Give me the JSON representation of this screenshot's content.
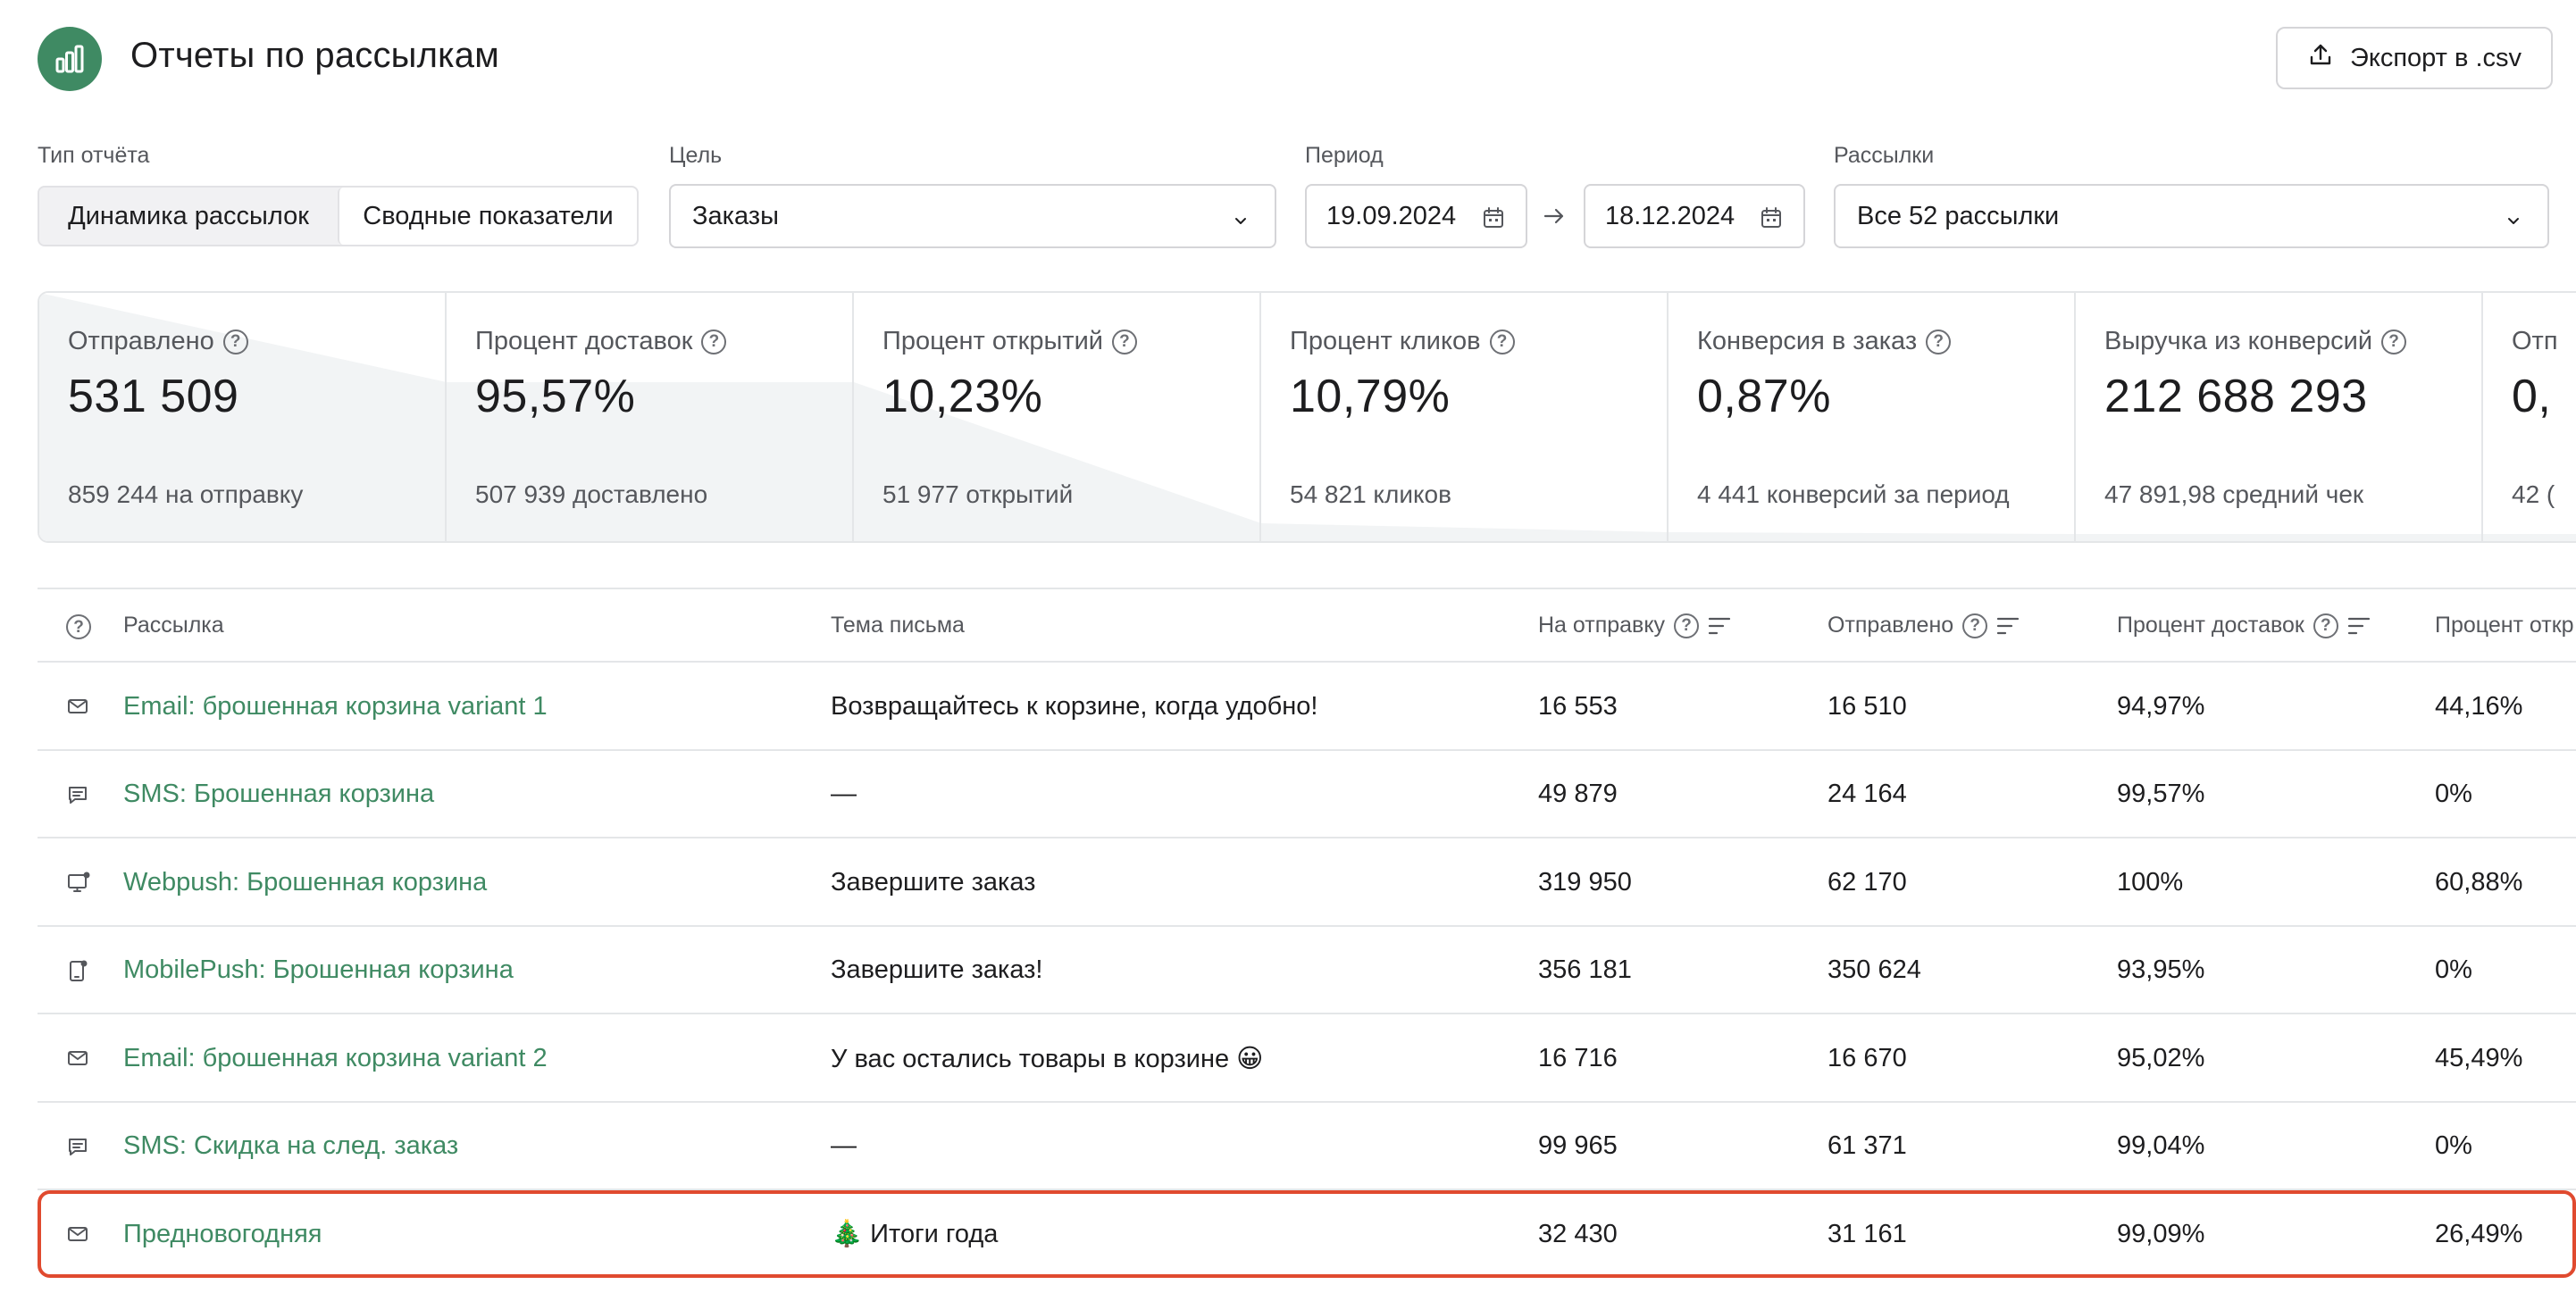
{
  "header": {
    "title": "Отчеты по рассылкам",
    "export_label": "Экспорт в .csv"
  },
  "filters": {
    "report_type": {
      "label": "Тип отчёта",
      "options": [
        "Динамика рассылок",
        "Сводные показатели"
      ],
      "selected": "Динамика рассылок"
    },
    "goal": {
      "label": "Цель",
      "value": "Заказы"
    },
    "period": {
      "label": "Период",
      "from": "19.09.2024",
      "to": "18.12.2024"
    },
    "campaigns": {
      "label": "Рассылки",
      "value": "Все 52 рассылки"
    }
  },
  "metrics": [
    {
      "title": "Отправлено",
      "value": "531 509",
      "sub": "859 244 на отправку"
    },
    {
      "title": "Процент доставок",
      "value": "95,57%",
      "sub": "507 939 доставлено"
    },
    {
      "title": "Процент открытий",
      "value": "10,23%",
      "sub": "51 977 открытий"
    },
    {
      "title": "Процент кликов",
      "value": "10,79%",
      "sub": "54 821 кликов"
    },
    {
      "title": "Конверсия в заказ",
      "value": "0,87%",
      "sub": "4 441 конверсий за период"
    },
    {
      "title": "Выручка из конверсий",
      "value": "212 688 293",
      "sub": "47 891,98 средний чек"
    },
    {
      "title": "Отп",
      "value": "0,",
      "sub": "42 ("
    }
  ],
  "table": {
    "columns": {
      "campaign": "Рассылка",
      "subject": "Тема письма",
      "to_send": "На отправку",
      "sent": "Отправлено",
      "delivery": "Процент доставок",
      "open": "Процент откр"
    },
    "rows": [
      {
        "channel_icon": "mail-icon",
        "name": "Email: брошенная корзина variant 1",
        "subject": "Возвращайтесь к корзине, когда удобно!",
        "to_send": "16 553",
        "sent": "16 510",
        "delivery": "94,97%",
        "open": "44,16%"
      },
      {
        "channel_icon": "sms-icon",
        "name": "SMS: Брошенная корзина",
        "subject": "—",
        "to_send": "49 879",
        "sent": "24 164",
        "delivery": "99,57%",
        "open": "0%"
      },
      {
        "channel_icon": "webpush-icon",
        "name": "Webpush: Брошенная корзина",
        "subject": "Завершите заказ",
        "to_send": "319 950",
        "sent": "62 170",
        "delivery": "100%",
        "open": "60,88%"
      },
      {
        "channel_icon": "mobilepush-icon",
        "name": "MobilePush: Брошенная корзина",
        "subject": "Завершите заказ!",
        "to_send": "356 181",
        "sent": "350 624",
        "delivery": "93,95%",
        "open": "0%"
      },
      {
        "channel_icon": "mail-icon",
        "name": "Email: брошенная корзина variant 2",
        "subject": "У вас остались товары в корзине 😀",
        "to_send": "16 716",
        "sent": "16 670",
        "delivery": "95,02%",
        "open": "45,49%"
      },
      {
        "channel_icon": "sms-icon",
        "name": "SMS: Скидка на след. заказ",
        "subject": "—",
        "to_send": "99 965",
        "sent": "61 371",
        "delivery": "99,04%",
        "open": "0%"
      },
      {
        "channel_icon": "mail-icon",
        "name": "Предновогодняя",
        "subject": "🎄 Итоги года",
        "to_send": "32 430",
        "sent": "31 161",
        "delivery": "99,09%",
        "open": "26,49%"
      }
    ]
  },
  "colors": {
    "brand": "#3f8a63",
    "highlight": "#e04a2f"
  }
}
